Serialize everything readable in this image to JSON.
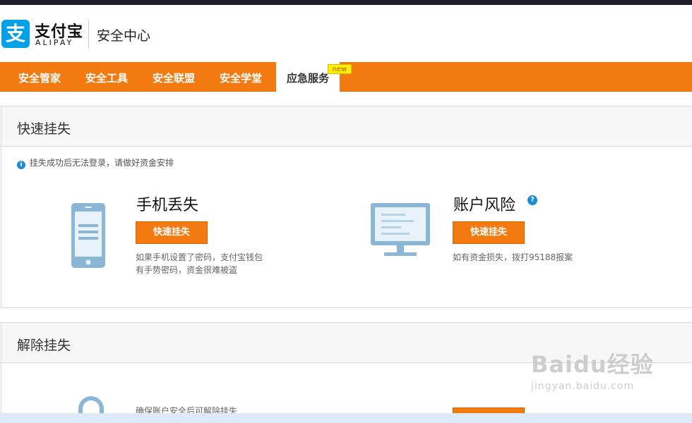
{
  "brand": {
    "logo_glyph": "支",
    "name_cn": "支付宝",
    "name_en": "ALIPAY",
    "site_title": "安全中心",
    "accent_color": "#f27a10",
    "logo_color": "#00a1e9"
  },
  "nav": {
    "items": [
      {
        "label": "安全管家"
      },
      {
        "label": "安全工具"
      },
      {
        "label": "安全联盟"
      },
      {
        "label": "安全学堂"
      },
      {
        "label": "应急服务"
      }
    ],
    "active_index": 4,
    "new_badge": "new"
  },
  "quick_report": {
    "title": "快速挂失",
    "notice": "挂失成功后无法登录，请做好资金安排",
    "phone_lost": {
      "title": "手机丢失",
      "button": "快速挂失",
      "desc_line1": "如果手机设置了密码，支付宝钱包",
      "desc_line2": "有手势密码，资金很难被盗",
      "icon": "phone-icon"
    },
    "account_risk": {
      "title": "账户风险",
      "help": "?",
      "button": "快速挂失",
      "desc": "如有资金损失，拨打95188报案",
      "icon": "monitor-icon"
    }
  },
  "unlock": {
    "title": "解除挂失",
    "desc": "确保账户安全后可解除挂失",
    "icon": "lock-icon"
  },
  "watermark": {
    "main": "Baidu经验",
    "sub": "jingyan.baidu.com"
  }
}
